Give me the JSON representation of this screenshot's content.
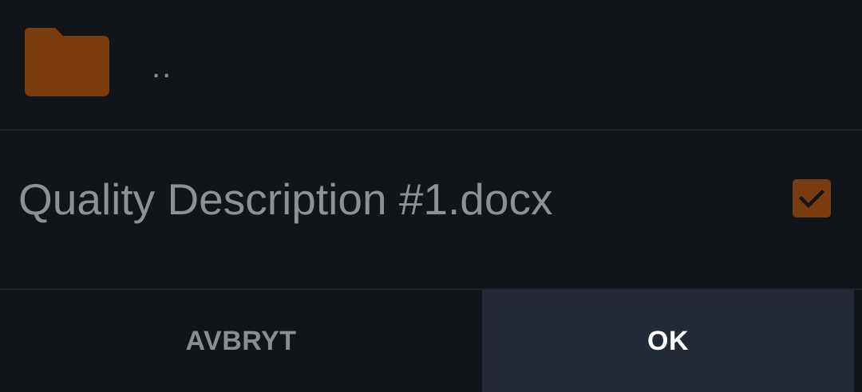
{
  "list": {
    "parent": {
      "label": "..",
      "icon": "folder-icon",
      "icon_color": "#7a3c0e"
    },
    "file": {
      "name": "Quality Description #1.docx",
      "checked": true,
      "check_color": "#7a3c0e"
    }
  },
  "buttons": {
    "cancel_label": "AVBRYT",
    "ok_label": "OK"
  }
}
